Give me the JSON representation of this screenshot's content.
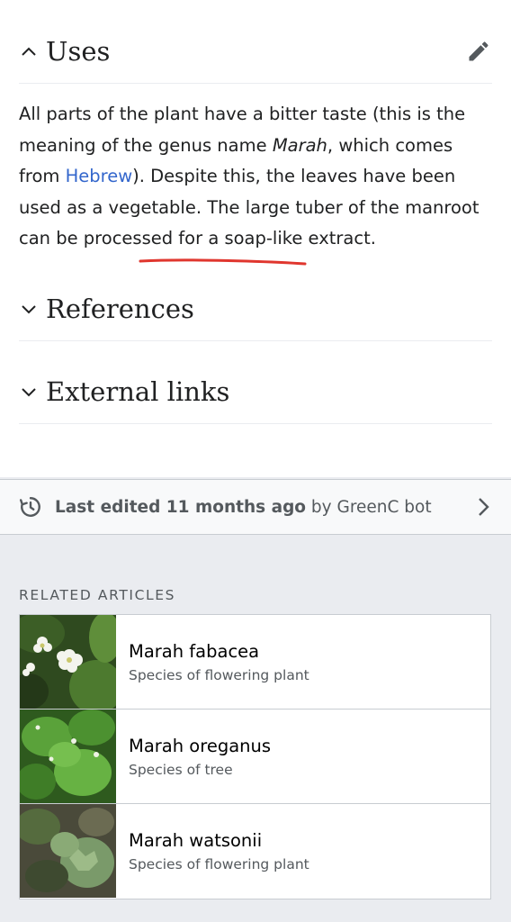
{
  "sections": {
    "uses": {
      "title": "Uses",
      "edit_icon": "pencil-icon"
    },
    "references": {
      "title": "References"
    },
    "external_links": {
      "title": "External links"
    }
  },
  "uses_paragraph": {
    "part1": "All parts of the plant have a bitter taste (this is the meaning of the genus name ",
    "genus_name": "Marah",
    "part2": ", which comes from ",
    "link_text": "Hebrew",
    "part3": "). Despite this, the leaves have been used as a vegetable. The large tuber of the manroot can be processed for a soap-like extract."
  },
  "annotation": {
    "underline_color": "#e0362e"
  },
  "last_edited": {
    "icon": "history-icon",
    "bold_text": "Last edited 11 months ago",
    "by_text": " by GreenC bot",
    "chevron": "chevron-right-icon"
  },
  "related": {
    "heading": "RELATED ARTICLES",
    "items": [
      {
        "title": "Marah fabacea",
        "description": "Species of flowering plant",
        "thumbnail": "white-flowers-photo"
      },
      {
        "title": "Marah oreganus",
        "description": "Species of tree",
        "thumbnail": "green-leaves-photo"
      },
      {
        "title": "Marah watsonii",
        "description": "Species of flowering plant",
        "thumbnail": "lobed-leaves-photo"
      }
    ]
  },
  "colors": {
    "link": "#3366cc",
    "text": "#202122",
    "muted": "#54595d",
    "gray_background": "#eaecf0"
  }
}
